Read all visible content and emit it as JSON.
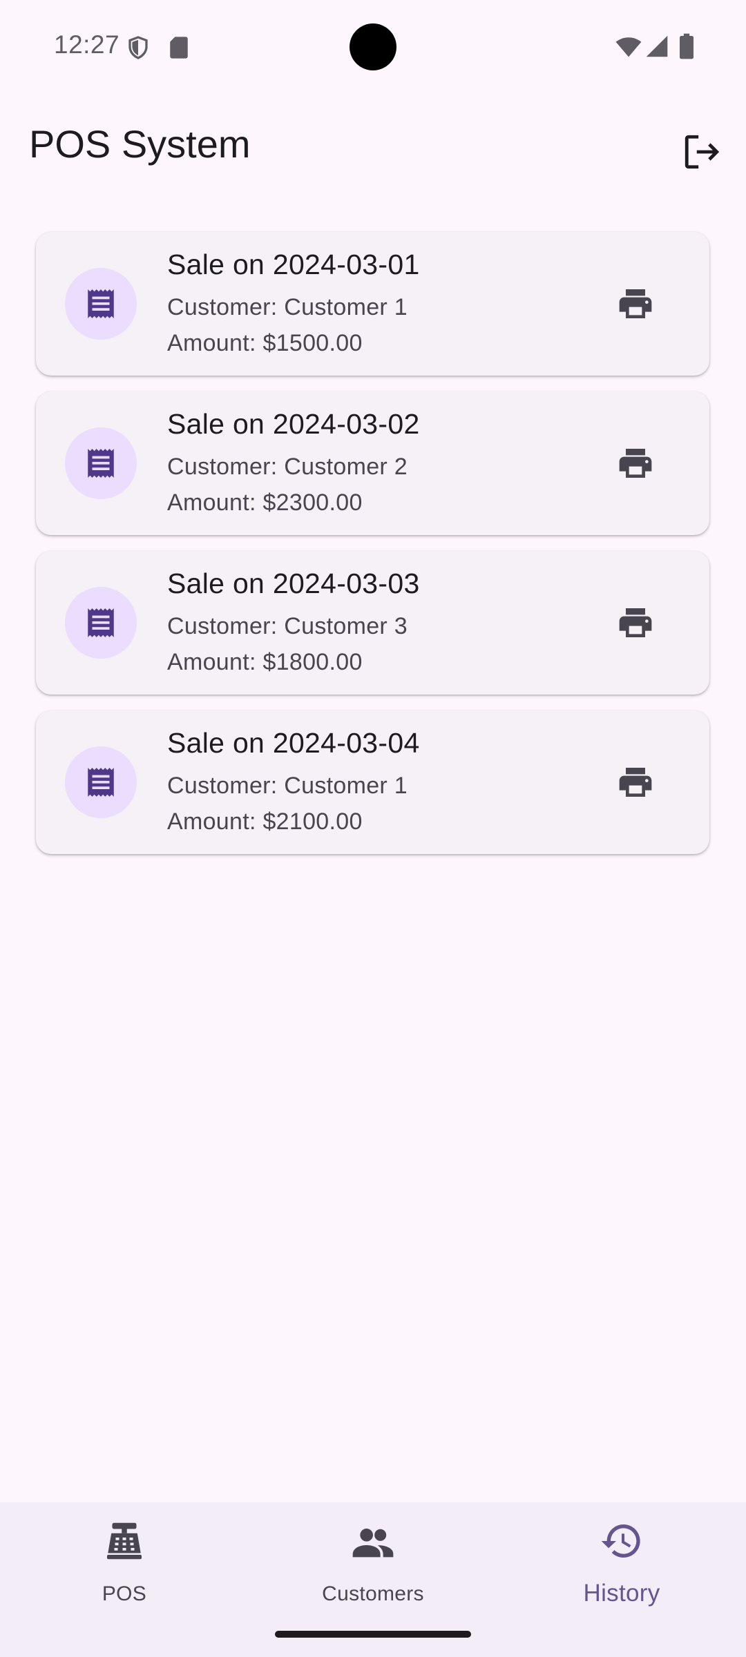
{
  "status_bar": {
    "time": "12:27",
    "icons": [
      "shield-icon",
      "sd-card-icon",
      "wifi-icon",
      "cell-signal-icon",
      "battery-icon"
    ]
  },
  "app_bar": {
    "title": "POS System",
    "action_icon": "logout-icon"
  },
  "sales": [
    {
      "title": "Sale on 2024-03-01",
      "customer": "Customer: Customer 1",
      "amount": "Amount: $1500.00"
    },
    {
      "title": "Sale on 2024-03-02",
      "customer": "Customer: Customer 2",
      "amount": "Amount: $2300.00"
    },
    {
      "title": "Sale on 2024-03-03",
      "customer": "Customer: Customer 3",
      "amount": "Amount: $1800.00"
    },
    {
      "title": "Sale on 2024-03-04",
      "customer": "Customer: Customer 1",
      "amount": "Amount: $2100.00"
    }
  ],
  "bottom_nav": {
    "items": [
      {
        "label": "POS",
        "icon": "cash-register-icon",
        "active": false
      },
      {
        "label": "Customers",
        "icon": "people-icon",
        "active": false
      },
      {
        "label": "History",
        "icon": "history-icon",
        "active": true
      }
    ]
  },
  "colors": {
    "background": "#fdf7fd",
    "card": "#f6f1f7",
    "avatar_bg": "#eaddfd",
    "accent": "#65558f",
    "receipt_icon": "#4f378a",
    "nav_bg": "#f3edf7"
  }
}
